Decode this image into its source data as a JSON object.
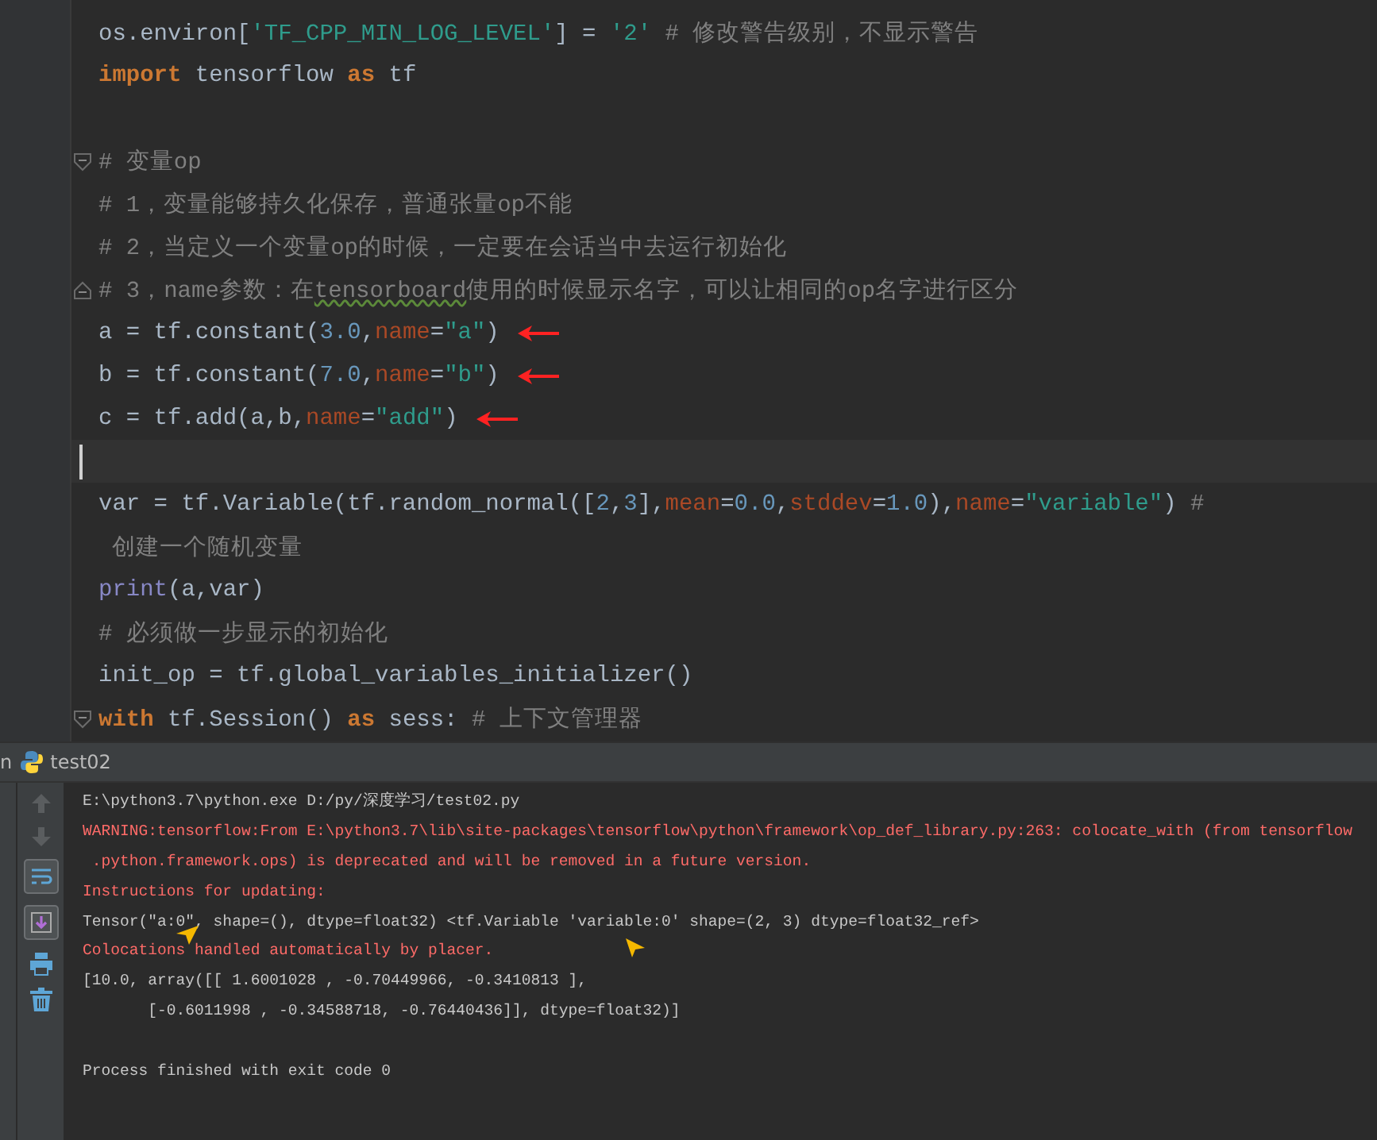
{
  "editor": {
    "lines": [
      {
        "segments": [
          {
            "kind": "plain",
            "text": "os.environ["
          },
          {
            "kind": "string",
            "text": "'TF_CPP_MIN_LOG_LEVEL'"
          },
          {
            "kind": "plain",
            "text": "] = "
          },
          {
            "kind": "string",
            "text": "'2'"
          },
          {
            "kind": "comment",
            "text": " # 修改警告级别，不显示警告"
          }
        ]
      },
      {
        "blank_after": true,
        "segments": [
          {
            "kind": "keyword",
            "text": "import"
          },
          {
            "kind": "plain",
            "text": " tensorflow "
          },
          {
            "kind": "keyword",
            "text": "as"
          },
          {
            "kind": "plain",
            "text": " tf"
          }
        ]
      },
      {
        "fold_open": true,
        "segments": [
          {
            "kind": "comment",
            "text": "# 变量op"
          }
        ]
      },
      {
        "segments": [
          {
            "kind": "comment",
            "text": "# 1，变量能够持久化保存，普通张量op不能"
          }
        ]
      },
      {
        "segments": [
          {
            "kind": "comment",
            "text": "# 2，当定义一个变量op的时候，一定要在会话当中去运行初始化"
          }
        ]
      },
      {
        "fold_close": true,
        "segments": [
          {
            "kind": "comment",
            "text": "# 3，name参数：在"
          },
          {
            "kind": "typo",
            "text": "tensorboard"
          },
          {
            "kind": "comment",
            "text": "使用的时候显示名字，可以让相同的op名字进行区分"
          }
        ]
      },
      {
        "marked": true,
        "segments": [
          {
            "kind": "plain",
            "text": "a = tf.constant("
          },
          {
            "kind": "number",
            "text": "3.0"
          },
          {
            "kind": "plain",
            "text": ","
          },
          {
            "kind": "param",
            "text": "name"
          },
          {
            "kind": "plain",
            "text": "="
          },
          {
            "kind": "string",
            "text": "\"a\""
          },
          {
            "kind": "plain",
            "text": ")"
          }
        ]
      },
      {
        "marked": true,
        "segments": [
          {
            "kind": "plain",
            "text": "b = tf.constant("
          },
          {
            "kind": "number",
            "text": "7.0"
          },
          {
            "kind": "plain",
            "text": ","
          },
          {
            "kind": "param",
            "text": "name"
          },
          {
            "kind": "plain",
            "text": "="
          },
          {
            "kind": "string",
            "text": "\"b\""
          },
          {
            "kind": "plain",
            "text": ")"
          }
        ]
      },
      {
        "marked": true,
        "segments": [
          {
            "kind": "plain",
            "text": "c = tf.add(a,b,"
          },
          {
            "kind": "param",
            "text": "name"
          },
          {
            "kind": "plain",
            "text": "="
          },
          {
            "kind": "string",
            "text": "\"add\""
          },
          {
            "kind": "plain",
            "text": ")"
          }
        ]
      },
      {
        "current": true
      },
      {
        "segments": [
          {
            "kind": "plain",
            "text": "var = tf.Variable(tf.random_normal(["
          },
          {
            "kind": "number",
            "text": "2"
          },
          {
            "kind": "plain",
            "text": ","
          },
          {
            "kind": "number",
            "text": "3"
          },
          {
            "kind": "plain",
            "text": "],"
          },
          {
            "kind": "param",
            "text": "mean"
          },
          {
            "kind": "plain",
            "text": "="
          },
          {
            "kind": "number",
            "text": "0.0"
          },
          {
            "kind": "plain",
            "text": ","
          },
          {
            "kind": "param",
            "text": "stddev"
          },
          {
            "kind": "plain",
            "text": "="
          },
          {
            "kind": "number",
            "text": "1.0"
          },
          {
            "kind": "plain",
            "text": "),"
          },
          {
            "kind": "param",
            "text": "name"
          },
          {
            "kind": "plain",
            "text": "="
          },
          {
            "kind": "string",
            "text": "\"variable\""
          },
          {
            "kind": "plain",
            "text": ") "
          },
          {
            "kind": "comment",
            "text": "#"
          }
        ]
      },
      {
        "segments": [
          {
            "kind": "comment",
            "text": " 创建一个随机变量"
          }
        ]
      },
      {
        "segments": [
          {
            "kind": "builtin",
            "text": "print"
          },
          {
            "kind": "plain",
            "text": "(a,var)"
          }
        ]
      },
      {
        "segments": [
          {
            "kind": "comment",
            "text": "# 必须做一步显示的初始化"
          }
        ]
      },
      {
        "segments": [
          {
            "kind": "plain",
            "text": "init_op = tf.global_variables_initializer()"
          }
        ]
      },
      {
        "fold_open": true,
        "segments": [
          {
            "kind": "keyword",
            "text": "with"
          },
          {
            "kind": "plain",
            "text": " tf.Session() "
          },
          {
            "kind": "keyword",
            "text": "as"
          },
          {
            "kind": "plain",
            "text": " sess: "
          },
          {
            "kind": "comment",
            "text": "# 上下文管理器"
          }
        ]
      }
    ]
  },
  "run_panel": {
    "tab_prefix": "n",
    "tab": "test02",
    "lines": [
      {
        "kind": "plain",
        "text": "E:\\python3.7\\python.exe D:/py/深度学习/test02.py"
      },
      {
        "kind": "error",
        "text": "WARNING:tensorflow:From E:\\python3.7\\lib\\site-packages\\tensorflow\\python\\framework\\op_def_library.py:263: colocate_with (from tensorflow"
      },
      {
        "kind": "error",
        "text": " .python.framework.ops) is deprecated and will be removed in a future version."
      },
      {
        "kind": "error",
        "text": "Instructions for updating:"
      },
      {
        "kind": "plain",
        "text": "Tensor(\"a:0\", shape=(), dtype=float32) <tf.Variable 'variable:0' shape=(2, 3) dtype=float32_ref>"
      },
      {
        "kind": "error",
        "text": "Colocations handled automatically by placer."
      },
      {
        "kind": "plain",
        "text": "[10.0, array([[ 1.6001028 , -0.70449966, -0.3410813 ],"
      },
      {
        "kind": "plain",
        "text": "       [-0.6011998 , -0.34588718, -0.76440436]], dtype=float32)]"
      },
      {
        "kind": "blank"
      },
      {
        "kind": "plain",
        "text": "Process finished with exit code 0"
      }
    ]
  }
}
